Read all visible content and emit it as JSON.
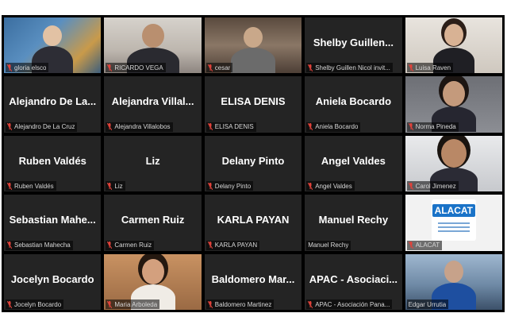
{
  "participants": [
    {
      "display": "",
      "label": "gloria elsco",
      "video": true
    },
    {
      "display": "",
      "label": "RICARDO VEGA",
      "video": true
    },
    {
      "display": "",
      "label": "cesar",
      "video": true
    },
    {
      "display": "Shelby Guillen...",
      "label": "Shelby Guillen Nicol invit...",
      "video": false
    },
    {
      "display": "",
      "label": "Luisa Raven",
      "video": true
    },
    {
      "display": "Alejandro De La...",
      "label": "Alejandro De La Cruz",
      "video": false
    },
    {
      "display": "Alejandra Villal...",
      "label": "Alejandra Villalobos",
      "video": false
    },
    {
      "display": "ELISA DENIS",
      "label": "ELISA DENIS",
      "video": false
    },
    {
      "display": "Aniela Bocardo",
      "label": "Aniela Bocardo",
      "video": false
    },
    {
      "display": "",
      "label": "Norma Pineda",
      "video": true
    },
    {
      "display": "Ruben Valdés",
      "label": "Ruben Valdés",
      "video": false
    },
    {
      "display": "Liz",
      "label": "Liz",
      "video": false
    },
    {
      "display": "Delany Pinto",
      "label": "Delany Pinto",
      "video": false
    },
    {
      "display": "Angel Valdes",
      "label": "Angel Valdes",
      "video": false
    },
    {
      "display": "",
      "label": "Carol Jimenez",
      "video": true
    },
    {
      "display": "Sebastian Mahe...",
      "label": "Sebastian Mahecha",
      "video": false
    },
    {
      "display": "Carmen Ruiz",
      "label": "Carmen Ruiz",
      "video": false
    },
    {
      "display": "KARLA PAYAN",
      "label": "KARLA PAYAN",
      "video": false
    },
    {
      "display": "Manuel Rechy",
      "label": "Manuel Rechy",
      "video": false
    },
    {
      "display": "",
      "label": "ALACAT",
      "video": true,
      "logo": "ALACAT"
    },
    {
      "display": "Jocelyn Bocardo",
      "label": "Jocelyn Bocardo",
      "video": false
    },
    {
      "display": "",
      "label": "Maria Arboleda",
      "video": true
    },
    {
      "display": "Baldomero Mar...",
      "label": "Baldomero Martinez",
      "video": false
    },
    {
      "display": "APAC - Asociaci...",
      "label": "APAC - Asociación Pana...",
      "video": false
    },
    {
      "display": "",
      "label": "Edgar Urrutia",
      "video": true
    }
  ],
  "colors": {
    "background": "#000000",
    "tile": "#242424",
    "muted_icon": "#e0423a",
    "name_text": "#ffffff"
  },
  "icons": {
    "muted": "microphone-muted-icon"
  }
}
